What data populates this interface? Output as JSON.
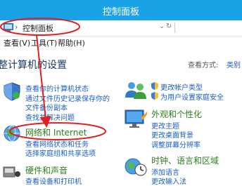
{
  "window": {
    "title": "控制面板"
  },
  "address": {
    "path": "控制面板",
    "refresh_glyph": "↻",
    "dropdown_glyph": "⌄"
  },
  "menu": {
    "view": "查看(V)",
    "tools": "工具(T)",
    "help": "帮助(H)"
  },
  "page": {
    "heading": "整计算机的设置",
    "view_by_label": "查看方式:",
    "view_by_value": "类别"
  },
  "categories": {
    "system": {
      "links": [
        "查看你的计算机状态",
        "通过文件历史记录保存你的",
        "文件备份副本",
        "查找并解决问题"
      ]
    },
    "network": {
      "title": "网络和 Internet",
      "links": [
        "查看网络状态和任务",
        "选择家庭组和共享选项"
      ]
    },
    "hardware": {
      "title": "硬件和声音",
      "links": [
        "查看设备和打印机"
      ]
    },
    "accounts": {
      "links": [
        "更改帐户类型",
        "为用户设置家庭安全"
      ]
    },
    "appearance": {
      "title": "外观和个性化",
      "links": [
        "更改主题",
        "更改桌面背景",
        "调整屏幕分辨率"
      ]
    },
    "clock": {
      "title": "时钟、语言和区域",
      "links": [
        "添加语言",
        "更改输入法"
      ]
    }
  },
  "colors": {
    "titlebar": "#1aa2e6",
    "annotation": "#e02020",
    "link": "#1a5ec2",
    "category": "#2f7d1f"
  }
}
